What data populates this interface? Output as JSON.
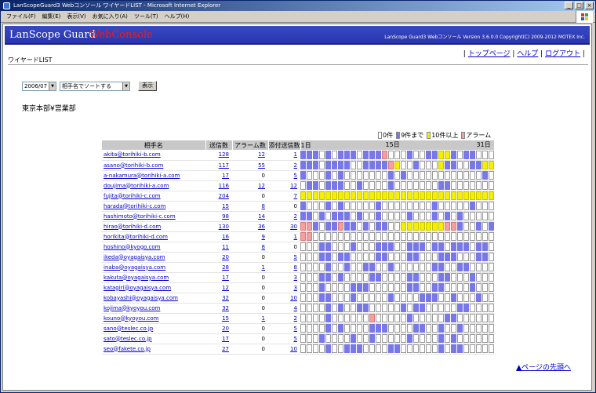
{
  "window": {
    "title": "LanScopeGuard3 Webコンソール ワイヤードLIST - Microsoft Internet Explorer",
    "min": "_",
    "max": "□",
    "close": "×"
  },
  "menu": [
    "ファイル(F)",
    "編集(E)",
    "表示(V)",
    "お気に入り(A)",
    "ツール(T)",
    "ヘルプ(H)"
  ],
  "banner": {
    "brand": "LanScope Guard",
    "brand2": "WebConsole",
    "copyright": "LanScope Guard3 Webコンソール Version 3.6.0.0   Copyright(C) 2009-2012 MOTEX Inc."
  },
  "page": {
    "title": "ワイヤードLIST",
    "links": [
      "トップページ",
      "ヘルプ",
      "ログアウト"
    ],
    "month": "2006/07",
    "sort": "相手名でソートする",
    "show": "表示",
    "dept": "東京本部¥営業部",
    "pagetop": "▲ページの先頭へ"
  },
  "legend": [
    {
      "label": "0件",
      "color": "#ffffff"
    },
    {
      "label": "9件まで",
      "color": "#7878e8"
    },
    {
      "label": "10件以上",
      "color": "#f4f000"
    },
    {
      "label": "アラーム",
      "color": "#f4a0a0"
    }
  ],
  "table": {
    "headers": [
      "相手名",
      "送信数",
      "アラーム数",
      "添付送信数"
    ],
    "day_labels": [
      "1日",
      "15日",
      "31日"
    ],
    "rows": [
      {
        "name": "akita@torihiki-b.com",
        "sent": "128",
        "alarm": "12",
        "attach": "1"
      },
      {
        "name": "asano@torihiki-b.com",
        "sent": "117",
        "alarm": "55",
        "attach": "2"
      },
      {
        "name": "a-nakamura@torihiki-a.com",
        "sent": "17",
        "alarm": "0",
        "attach": "5"
      },
      {
        "name": "doujima@torihiki-a.com",
        "sent": "116",
        "alarm": "12",
        "attach": "12"
      },
      {
        "name": "fujita@torihiki-c.com",
        "sent": "204",
        "alarm": "0",
        "attach": "7"
      },
      {
        "name": "harada@torihiki-c.com",
        "sent": "15",
        "alarm": "8",
        "attach": "0"
      },
      {
        "name": "hashimoto@torihiki-c.com",
        "sent": "98",
        "alarm": "14",
        "attach": "2"
      },
      {
        "name": "hirao@torihiki-d.com",
        "sent": "130",
        "alarm": "36",
        "attach": "30"
      },
      {
        "name": "horikita@torihiki-d.com",
        "sent": "16",
        "alarm": "9",
        "attach": "1"
      },
      {
        "name": "hoshino@kyogo.com",
        "sent": "11",
        "alarm": "8",
        "attach": "0"
      },
      {
        "name": "ikeda@oyagaisya.com",
        "sent": "20",
        "alarm": "0",
        "attach": "5"
      },
      {
        "name": "inaba@oyagaisya.com",
        "sent": "28",
        "alarm": "1",
        "attach": "8"
      },
      {
        "name": "kakuta@oyagaisya.com",
        "sent": "17",
        "alarm": "0",
        "attach": "3"
      },
      {
        "name": "katagiri@oyagaisya.com",
        "sent": "12",
        "alarm": "0",
        "attach": "3"
      },
      {
        "name": "kobayashi@oyagaisya.com",
        "sent": "32",
        "alarm": "0",
        "attach": "10"
      },
      {
        "name": "kojima@kyoyou.com",
        "sent": "32",
        "alarm": "0",
        "attach": "4"
      },
      {
        "name": "kouno@kyoyou.com",
        "sent": "15",
        "alarm": "1",
        "attach": "2"
      },
      {
        "name": "sano@teslec.co.jp",
        "sent": "20",
        "alarm": "0",
        "attach": "5"
      },
      {
        "name": "sato@teslec.co.jp",
        "sent": "17",
        "alarm": "0",
        "attach": "5"
      },
      {
        "name": "seo@fakete.co.jp",
        "sent": "27",
        "alarm": "0",
        "attach": "10"
      }
    ],
    "calendar": [
      "lllwlwlllwlllpwwwlwwllyylwllwwwyyppl",
      "lllwllllwwllllpywwlwwwyllwwllyylpl",
      "lwwwlwlwwwwwwwlwlwwwwwwwwwwwwlwww",
      "wllwlllwwlwwwwlwwwwwwwllwwwwwwwww",
      "yyyyyyyyyyyyyyyyyyyyyyyyyyyyyyyp",
      "lwwwlwlwwwwwlwwwwwwwwlwwwwwlwwwww",
      "llwlwlllwlwwlwwwwlwwwlwlwlwwwwwww",
      "pplwllpllwlwllwwyyyyyyypplwwlwlww",
      "ppwwwwwwwwwwwwwwwwwwwwwwwwwwwwwww",
      "wwwllwwwlwwwlllwwlllwllwlllwllwww",
      "wwwllwllwwwwllwwwllwwwlllwwwllwww",
      "wwwwlwwlwwllwwlwwwwwwllwwllwwwwww",
      "wwwllwlwwwwllwwwwllwwwllwwwlwwwww",
      "wwwlwwwwlllwwwwwwllwwllwwwwlwwwww",
      "wwwllwwwlwwwwwlwwwwlllwwlwwwlwwww",
      "wwwwlwlwwllwwwwwlwllwwwwwllwwwwww",
      "wwwwlwwwwwwpwwwwwlwwwwwllwwwwwwww",
      "wwwwlwlwwwwlllwwwwllwwlwwlwwwwwww",
      "wwwlwwwwlwwlwwwwwlwwwwlwlwwwwwwww",
      "wwwwlwwlllwwwwllwwwwwwlwllwwwwwww"
    ]
  }
}
